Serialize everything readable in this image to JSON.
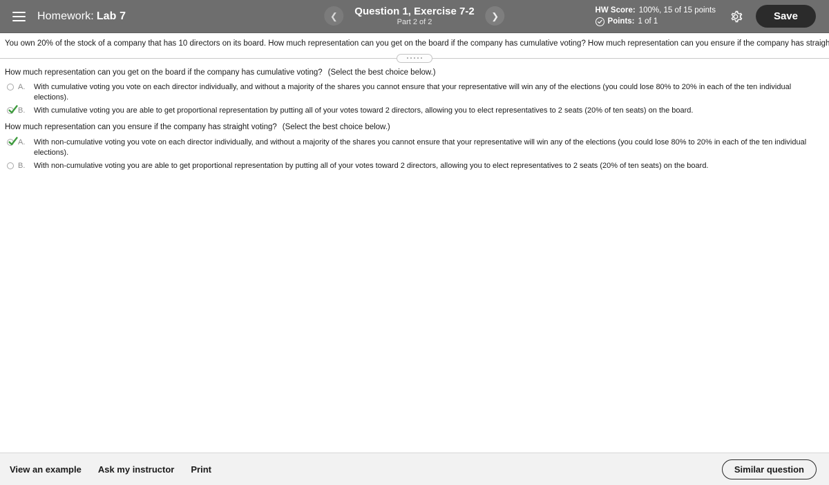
{
  "header": {
    "menu_icon": "hamburger-menu-icon",
    "course_label": "Homework:",
    "assignment_name": "Lab 7",
    "prev_icon": "chevron-left-icon",
    "next_icon": "chevron-right-icon",
    "question_title": "Question 1, Exercise 7-2",
    "question_part": "Part 2 of 2",
    "hw_score_label": "HW Score:",
    "hw_score_value": "100%, 15 of 15 points",
    "points_label": "Points:",
    "points_value": "1 of 1",
    "points_status_icon": "check-circle-icon",
    "settings_icon": "gear-icon",
    "save_label": "Save",
    "colors": {
      "header_bg": "#6e6e6e",
      "save_bg": "#2b2b2b",
      "check_green": "#2f9e44"
    }
  },
  "question": {
    "stem": "You own 20% of the stock of a company that has 10 directors on its board. How much representation can you get on the board if the company has cumulative voting? How much representation can you ensure if the company has straight voting?",
    "drag_handle_icon": "drag-handle-dots-icon"
  },
  "parts": [
    {
      "prompt": "How much representation can you get on the board if the company has cumulative voting?",
      "hint": "(Select the best choice below.)",
      "choices": [
        {
          "letter": "A.",
          "text": "With cumulative voting you vote on each director individually, and without a majority of the shares you cannot ensure that your representative will win any of the elections (you could lose 80% to 20% in each of the ten individual elections).",
          "selected": false
        },
        {
          "letter": "B.",
          "text": "With cumulative voting you are able to get proportional representation by putting all of your votes toward 2 directors, allowing you to elect representatives to 2 seats (20% of ten seats) on the board.",
          "selected": true
        }
      ]
    },
    {
      "prompt": "How much representation can you ensure if the company has straight voting?",
      "hint": "(Select the best choice below.)",
      "choices": [
        {
          "letter": "A.",
          "text": "With non-cumulative voting you vote on each director individually, and without a majority of the shares you cannot ensure that your representative will win any of the elections (you could lose 80% to 20% in each of the ten individual elections).",
          "selected": true
        },
        {
          "letter": "B.",
          "text": "With non-cumulative voting you are able to get proportional representation by putting all of your votes toward 2 directors, allowing you to elect representatives to 2 seats (20% of ten seats) on the board.",
          "selected": false
        }
      ]
    }
  ],
  "footer": {
    "links": [
      {
        "label": "View an example"
      },
      {
        "label": "Ask my instructor"
      },
      {
        "label": "Print"
      }
    ],
    "similar_question_label": "Similar question"
  }
}
